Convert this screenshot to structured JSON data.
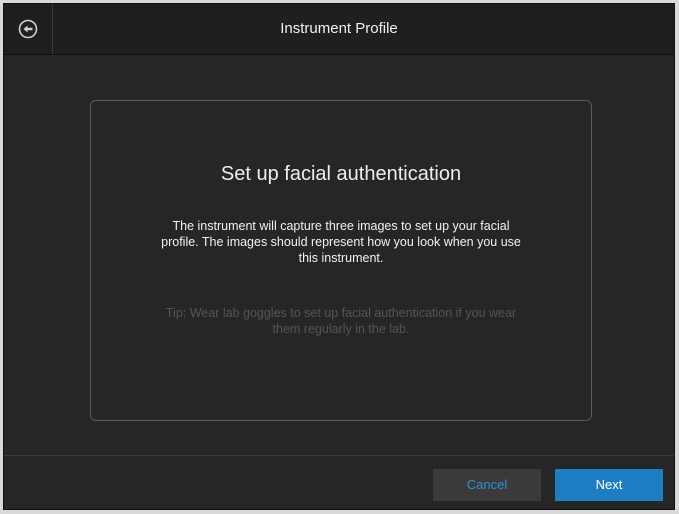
{
  "header": {
    "title": "Instrument Profile",
    "back_icon": "back-arrow-circle-icon"
  },
  "panel": {
    "heading": "Set up facial authentication",
    "description": "The instrument will capture three images to set up your facial profile. The images should represent how you look when you use this instrument.",
    "tip": "Tip: Wear lab goggles to set up facial authentication if you wear them regularly in the lab."
  },
  "footer": {
    "cancel_label": "Cancel",
    "next_label": "Next"
  },
  "colors": {
    "background": "#262626",
    "accent": "#1d7ec4",
    "link": "#2a93d8"
  }
}
